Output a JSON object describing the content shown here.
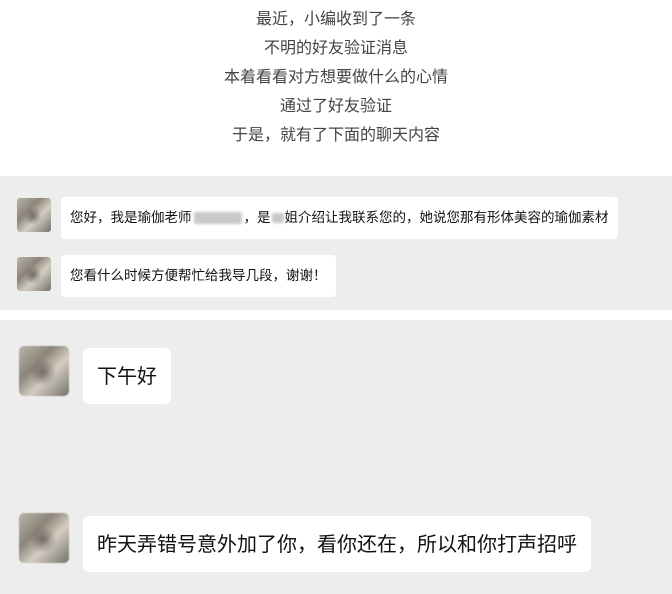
{
  "intro_lines": [
    "最近，小编收到了一条",
    "不明的好友验证消息",
    "本着看看对方想要做什么的心情",
    "通过了好友验证",
    "于是，就有了下面的聊天内容"
  ],
  "verification_messages": [
    {
      "part1": "您好，我是瑜伽老师",
      "part2": "，是",
      "part3": "姐介绍让我联系您的，她说您那有形体美容的瑜伽素材"
    },
    {
      "text": "您看什么时候方便帮忙给我导几段，谢谢！"
    }
  ],
  "chat_messages": [
    "下午好",
    "昨天弄错号意外加了你，看你还在，所以和你打声招呼"
  ],
  "colors": {
    "panel_background": "#ededed",
    "bubble_background": "#ffffff",
    "text": "#111111"
  }
}
